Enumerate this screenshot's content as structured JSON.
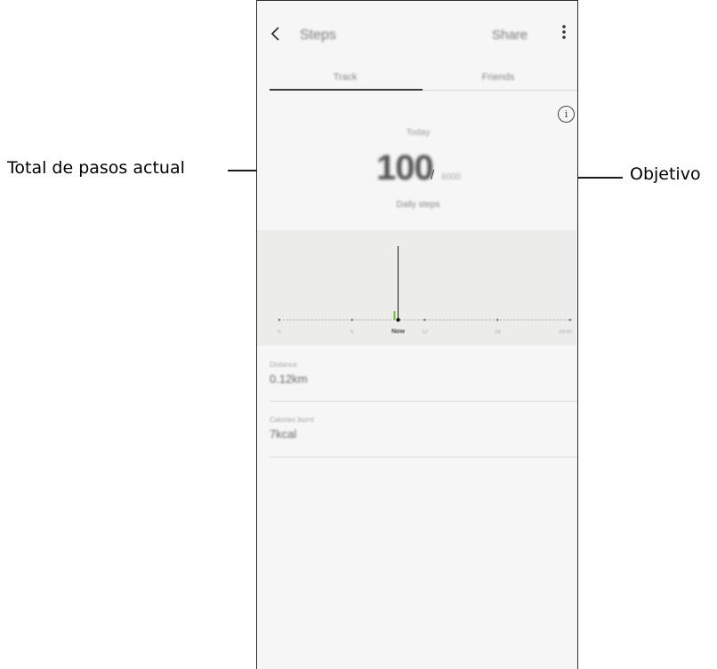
{
  "callouts": {
    "current_steps": "Total de pasos actual",
    "goal": "Objetivo"
  },
  "header": {
    "back_icon": "chevron-left-icon",
    "title": "Steps",
    "share_label": "Share",
    "more_icon": "more-vertical-icon"
  },
  "tabs": [
    {
      "label": "Track",
      "active": true
    },
    {
      "label": "Friends",
      "active": false
    }
  ],
  "summary": {
    "info_icon": "info-icon",
    "info_glyph": "i",
    "day": "Today",
    "steps": "100",
    "separator": "/",
    "goal": "6000",
    "caption": "Daily steps"
  },
  "chart_data": {
    "type": "bar",
    "x_ticks": [
      "0",
      "6",
      "Now",
      "12",
      "18",
      "24:00"
    ],
    "bars": [
      {
        "x_hour": 9.5,
        "value": 100
      }
    ],
    "colors": {
      "bar": "#6fbf3a",
      "now_marker": "#1a1a1a",
      "baseline": "#9a9a9a"
    }
  },
  "stats": [
    {
      "label": "Distance",
      "value": "0.12km"
    },
    {
      "label": "Calories burnt",
      "value": "7kcal"
    }
  ]
}
